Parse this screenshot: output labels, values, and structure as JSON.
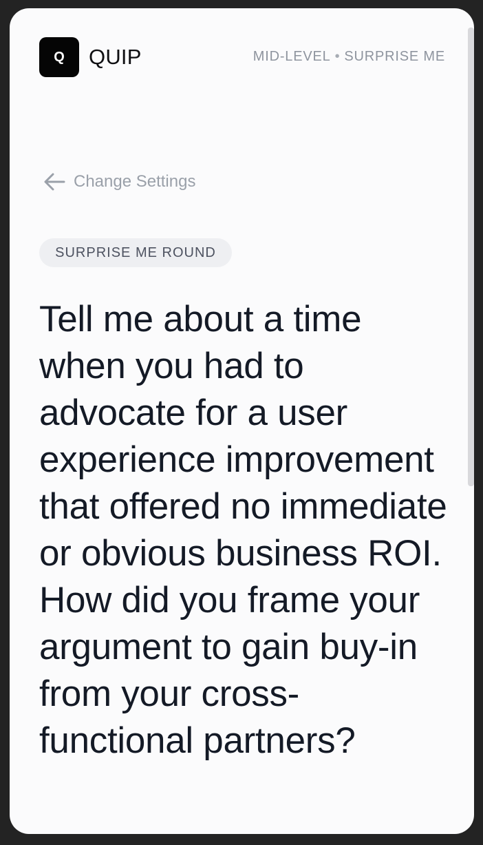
{
  "header": {
    "logo_letter": "Q",
    "app_name": "QUIP",
    "level": "MID-LEVEL",
    "separator": "•",
    "mode": "SURPRISE ME"
  },
  "nav": {
    "back_label": "Change Settings",
    "back_icon": "arrow-left-icon"
  },
  "round": {
    "badge": "SURPRISE ME ROUND"
  },
  "question": {
    "text": "Tell me about a time when you had to advocate for a user experience improvement that offered no immediate or obvious business ROI. How did you frame your argument to gain buy-in from your cross-functional partners?"
  },
  "colors": {
    "background": "#232323",
    "card": "#fbfbfc",
    "text_primary": "#141a26",
    "text_muted": "#8e949e",
    "pill_bg": "#eeeff2"
  }
}
